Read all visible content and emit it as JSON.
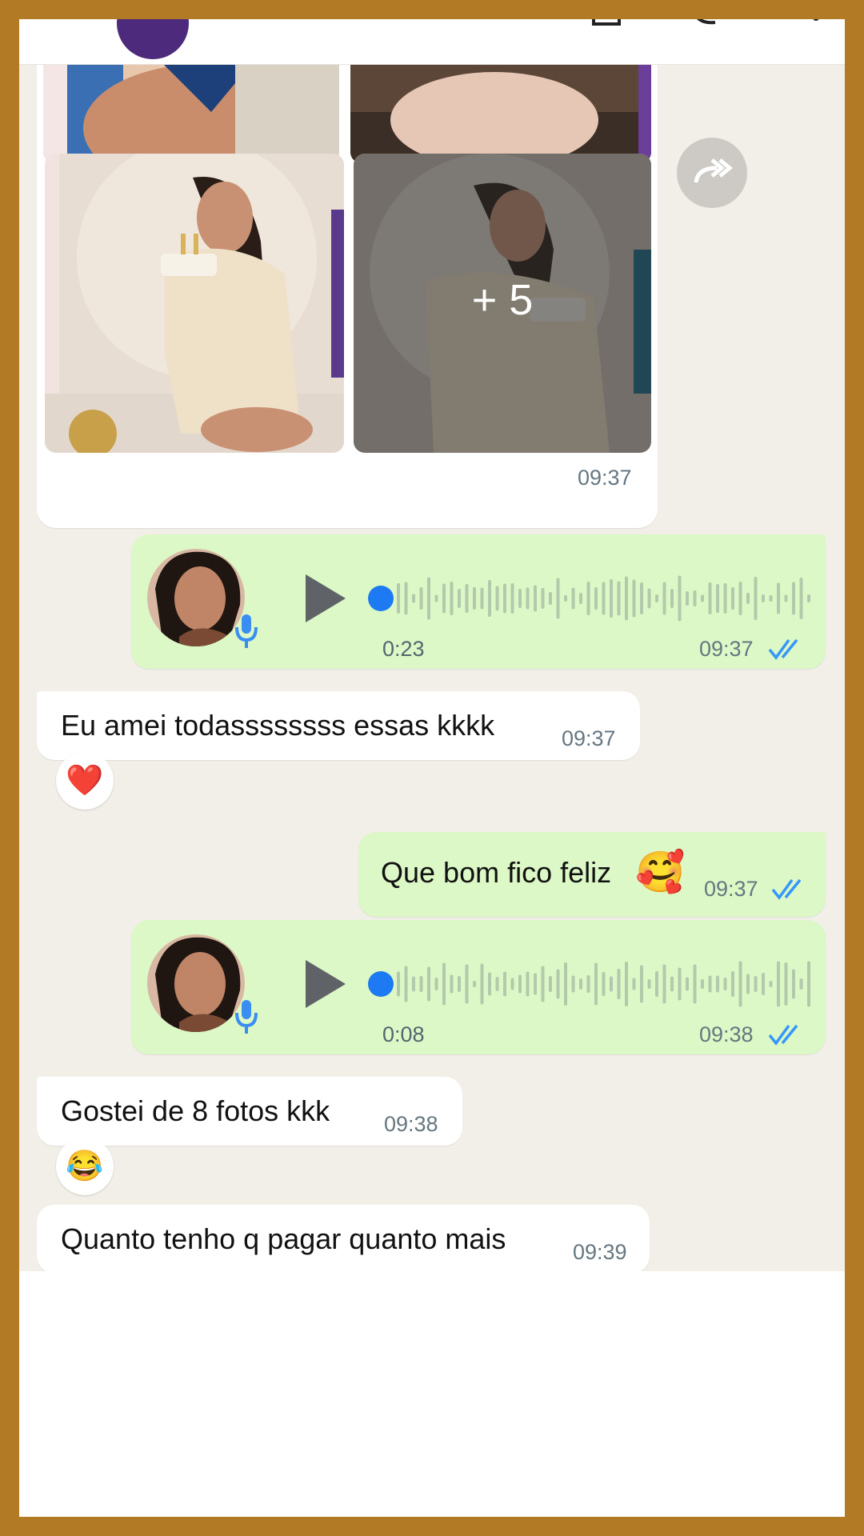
{
  "colors": {
    "chat_bg": "#f2efe9",
    "outgoing_bubble": "#dcf8c6",
    "incoming_bubble": "#ffffff",
    "read_ticks": "#3497f9",
    "voice_dot": "#1d7af3",
    "frame": "#b27a25"
  },
  "gallery": {
    "more_label": "+ 5",
    "time": "09:37",
    "forward_icon": "forward-icon"
  },
  "messages": [
    {
      "type": "voice",
      "direction": "out",
      "duration": "0:23",
      "time": "09:37",
      "status": "read"
    },
    {
      "type": "text",
      "direction": "in",
      "text": "Eu amei todassssssss essas kkkk",
      "time": "09:37",
      "reaction": "❤️"
    },
    {
      "type": "text",
      "direction": "out",
      "text": "Que bom fico feliz",
      "emoji": "🥰",
      "time": "09:37",
      "status": "read"
    },
    {
      "type": "voice",
      "direction": "out",
      "duration": "0:08",
      "time": "09:38",
      "status": "read"
    },
    {
      "type": "text",
      "direction": "in",
      "text": "Gostei de 8 fotos kkk",
      "time": "09:38",
      "reaction": "😂"
    },
    {
      "type": "text",
      "direction": "in",
      "text": "Quanto tenho q pagar quanto mais",
      "time": "09:39"
    }
  ]
}
